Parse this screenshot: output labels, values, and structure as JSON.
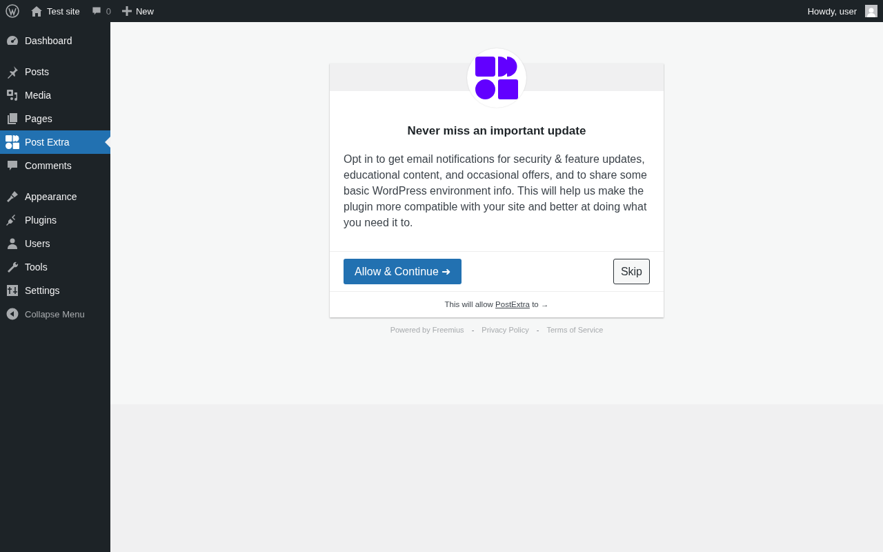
{
  "admin_bar": {
    "site_name": "Test site",
    "comments_count": "0",
    "new_label": "New",
    "greeting": "Howdy, user"
  },
  "sidebar": {
    "groups": [
      [
        {
          "label": "Dashboard",
          "selected": false
        }
      ],
      [
        {
          "label": "Posts",
          "selected": false
        },
        {
          "label": "Media",
          "selected": false
        },
        {
          "label": "Pages",
          "selected": false
        },
        {
          "label": "Post Extra",
          "selected": true
        },
        {
          "label": "Comments",
          "selected": false
        }
      ],
      [
        {
          "label": "Appearance",
          "selected": false
        },
        {
          "label": "Plugins",
          "selected": false
        },
        {
          "label": "Users",
          "selected": false
        },
        {
          "label": "Tools",
          "selected": false
        },
        {
          "label": "Settings",
          "selected": false
        }
      ]
    ],
    "collapse_label": "Collapse Menu"
  },
  "optin": {
    "title": "Never miss an important update",
    "message": "Opt in to get email notifications for security & feature updates, educational content, and occasional offers, and to share some basic WordPress environment info. This will help us make the plugin more compatible with your site and better at doing what you need it to.",
    "allow_button": "Allow & Continue ➜",
    "skip_button": "Skip",
    "permissions_prefix": "This will allow",
    "permissions_link": "PostExtra",
    "permissions_suffix": "to →"
  },
  "footer_links": [
    {
      "kind": "link",
      "text": "Powered by Freemius"
    },
    {
      "kind": "separator",
      "text": "-"
    },
    {
      "kind": "link",
      "text": "Privacy Policy"
    },
    {
      "kind": "separator",
      "text": "-"
    },
    {
      "kind": "link",
      "text": "Terms of Service"
    }
  ]
}
